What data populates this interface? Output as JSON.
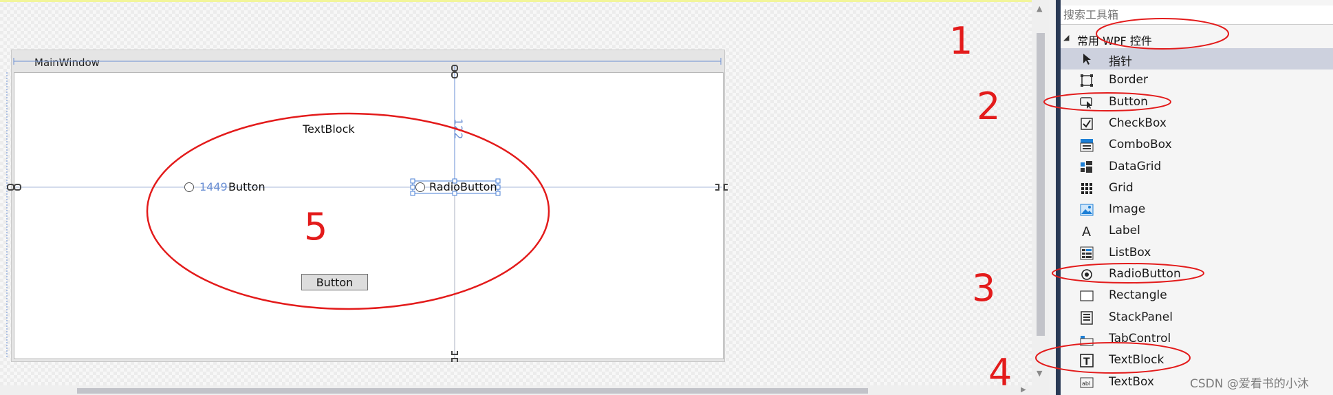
{
  "designer": {
    "window_title": "MainWindow",
    "textblock_text": "TextBlock",
    "left_radio_text": "Button",
    "right_radio_text": "RadioButton",
    "button_text": "Button",
    "margin_left": "1449",
    "margin_top": "122"
  },
  "toolbox": {
    "search_placeholder": "搜索工具箱",
    "category": "常用 WPF 控件",
    "items": [
      {
        "label": "指针",
        "icon": "pointer-icon"
      },
      {
        "label": "Border",
        "icon": "border-icon"
      },
      {
        "label": "Button",
        "icon": "button-icon"
      },
      {
        "label": "CheckBox",
        "icon": "checkbox-icon"
      },
      {
        "label": "ComboBox",
        "icon": "combobox-icon"
      },
      {
        "label": "DataGrid",
        "icon": "datagrid-icon"
      },
      {
        "label": "Grid",
        "icon": "grid-icon"
      },
      {
        "label": "Image",
        "icon": "image-icon"
      },
      {
        "label": "Label",
        "icon": "label-icon"
      },
      {
        "label": "ListBox",
        "icon": "listbox-icon"
      },
      {
        "label": "RadioButton",
        "icon": "radiobutton-icon"
      },
      {
        "label": "Rectangle",
        "icon": "rectangle-icon"
      },
      {
        "label": "StackPanel",
        "icon": "stackpanel-icon"
      },
      {
        "label": "TabControl",
        "icon": "tabcontrol-icon"
      },
      {
        "label": "TextBlock",
        "icon": "textblock-icon"
      },
      {
        "label": "TextBox",
        "icon": "textbox-icon"
      }
    ]
  },
  "annotations": {
    "n1": "1",
    "n2": "2",
    "n3": "3",
    "n4": "4",
    "n5": "5",
    "color": "#e31b1b"
  },
  "watermark": "CSDN @爱看书的小沐",
  "colors": {
    "toolbox_edge": "#293955",
    "selection": "#cdd1de",
    "guide_line": "#6a8fd4"
  }
}
